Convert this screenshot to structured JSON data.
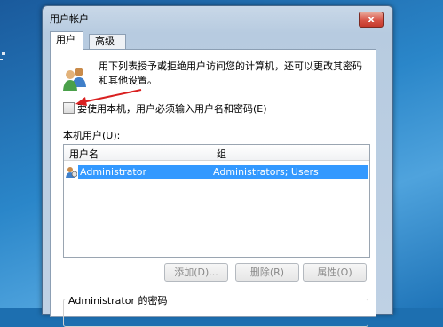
{
  "window": {
    "title": "用户帐户",
    "close_label": "x"
  },
  "tabs": [
    {
      "label": "用户",
      "active": true
    },
    {
      "label": "高级",
      "active": false
    }
  ],
  "users_tab": {
    "description": "用下列表授予或拒绝用户访问您的计算机，还可以更改其密码和其他设置。",
    "require_login_checkbox": {
      "label": "要使用本机，用户必须输入用户名和密码(E)",
      "checked": false
    },
    "local_users_label": "本机用户(U):",
    "columns": [
      "用户名",
      "组"
    ],
    "rows": [
      {
        "username": "Administrator",
        "group": "Administrators; Users",
        "selected": true
      }
    ],
    "buttons": {
      "add": "添加(D)...",
      "remove": "删除(R)",
      "properties": "属性(O)"
    },
    "password_group_title": "Administrator 的密码"
  },
  "colors": {
    "selection": "#3399ff",
    "arrow": "#d92020",
    "close_button": "#d9574a"
  },
  "icons": [
    "users-icon",
    "user-row-icon",
    "annotation-arrow",
    "close-icon"
  ]
}
